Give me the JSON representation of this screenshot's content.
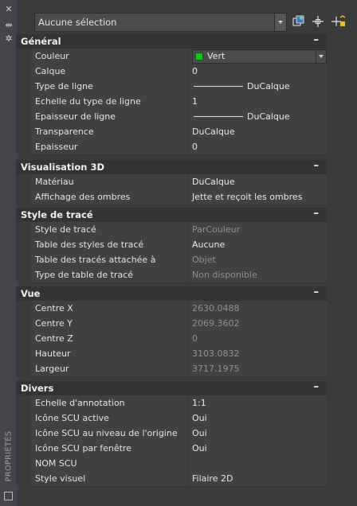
{
  "sidebar": {
    "title": "PROPRIÉTÉS"
  },
  "topbar": {
    "selection": "Aucune sélection"
  },
  "sections": {
    "general": {
      "title": "Général",
      "rows": [
        {
          "label": "Couleur",
          "value": "Vert"
        },
        {
          "label": "Calque",
          "value": "0"
        },
        {
          "label": "Type de ligne",
          "value": "DuCalque"
        },
        {
          "label": "Echelle du type de ligne",
          "value": "1"
        },
        {
          "label": "Epaisseur de ligne",
          "value": "DuCalque"
        },
        {
          "label": "Transparence",
          "value": "DuCalque"
        },
        {
          "label": "Epaisseur",
          "value": "0"
        }
      ]
    },
    "visu3d": {
      "title": "Visualisation 3D",
      "rows": [
        {
          "label": "Matériau",
          "value": "DuCalque"
        },
        {
          "label": "Affichage des ombres",
          "value": "Jette et reçoit les ombres"
        }
      ]
    },
    "plotstyle": {
      "title": "Style de tracé",
      "rows": [
        {
          "label": "Style de tracé",
          "value": "ParCouleur"
        },
        {
          "label": "Table des styles de tracé",
          "value": "Aucune"
        },
        {
          "label": "Table des tracés attachée à",
          "value": "Objet"
        },
        {
          "label": "Type de table de tracé",
          "value": "Non disponible"
        }
      ]
    },
    "vue": {
      "title": "Vue",
      "rows": [
        {
          "label": "Centre X",
          "value": "2630.0488"
        },
        {
          "label": "Centre Y",
          "value": "2069.3602"
        },
        {
          "label": "Centre Z",
          "value": "0"
        },
        {
          "label": "Hauteur",
          "value": "3103.0832"
        },
        {
          "label": "Largeur",
          "value": "3717.1975"
        }
      ]
    },
    "divers": {
      "title": "Divers",
      "rows": [
        {
          "label": "Echelle d'annotation",
          "value": "1:1"
        },
        {
          "label": "Icône SCU active",
          "value": "Oui"
        },
        {
          "label": "Icône SCU au niveau de l'origine",
          "value": "Oui"
        },
        {
          "label": "Icône SCU par fenêtre",
          "value": "Oui"
        },
        {
          "label": "NOM SCU",
          "value": ""
        },
        {
          "label": "Style visuel",
          "value": "Filaire 2D"
        }
      ]
    }
  },
  "colors": {
    "swatch": "#12c61a",
    "section_bg": "#333436",
    "row_bg": "#404143"
  }
}
